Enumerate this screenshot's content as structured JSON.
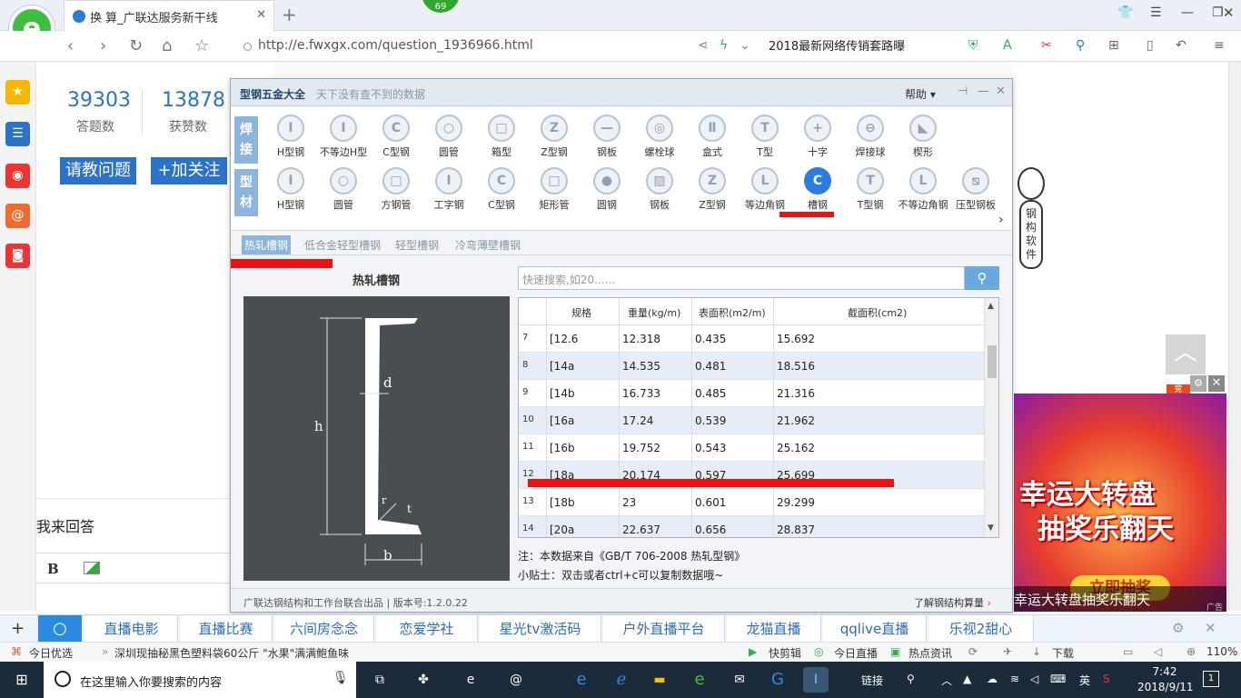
{
  "browser": {
    "tab_title": "换 算_广联达服务新干线",
    "badge": "69",
    "url": "http://e.fwxgx.com/question_1936966.html",
    "search_text": "2018最新网络传销套路曝"
  },
  "page": {
    "stat1_value": "39303",
    "stat1_label": "答题数",
    "stat2_value": "13878",
    "stat2_label": "获赞数",
    "ask_button": "请教问题",
    "follow_button": "+加关注",
    "reply_label": "我来回答",
    "bold_button": "B"
  },
  "dialog": {
    "title": "型钢五金大全",
    "subtitle": "天下没有查不到的数据",
    "help": "帮助",
    "row1_tag": "焊接",
    "row2_tag": "型材",
    "row1_items": [
      "H型钢",
      "不等边H型",
      "C型钢",
      "圆管",
      "箱型",
      "Z型钢",
      "钢板",
      "螺栓球",
      "盒式",
      "T型",
      "十字",
      "焊接球",
      "楔形"
    ],
    "row2_items": [
      "H型钢",
      "圆管",
      "方钢管",
      "工字钢",
      "C型钢",
      "矩形管",
      "圆钢",
      "钢板",
      "Z型钢",
      "等边角钢",
      "槽钢",
      "T型钢",
      "不等边角钢",
      "压型钢板"
    ],
    "sub_tabs": [
      "热轧槽钢",
      "低合金轻型槽钢",
      "轻型槽钢",
      "冷弯薄壁槽钢"
    ],
    "section_title": "热轧槽钢",
    "diagram_labels": {
      "h": "h",
      "d": "d",
      "b": "b",
      "t": "t",
      "r": "r"
    },
    "search_placeholder": "快速搜索,如20......",
    "columns": [
      "规格",
      "重量(kg/m)",
      "表面积(m2/m)",
      "截面积(cm2)"
    ],
    "rows": [
      {
        "n": "7",
        "spec": "[12.6",
        "w": "12.318",
        "s": "0.435",
        "a": "15.692"
      },
      {
        "n": "8",
        "spec": "[14a",
        "w": "14.535",
        "s": "0.481",
        "a": "18.516"
      },
      {
        "n": "9",
        "spec": "[14b",
        "w": "16.733",
        "s": "0.485",
        "a": "21.316"
      },
      {
        "n": "10",
        "spec": "[16a",
        "w": "17.24",
        "s": "0.539",
        "a": "21.962"
      },
      {
        "n": "11",
        "spec": "[16b",
        "w": "19.752",
        "s": "0.543",
        "a": "25.162"
      },
      {
        "n": "12",
        "spec": "[18a",
        "w": "20.174",
        "s": "0.597",
        "a": "25.699"
      },
      {
        "n": "13",
        "spec": "[18b",
        "w": "23",
        "s": "0.601",
        "a": "29.299"
      },
      {
        "n": "14",
        "spec": "[20a",
        "w": "22.637",
        "s": "0.656",
        "a": "28.837"
      }
    ],
    "note1": "注：本数据来自《GB/T  706-2008 热轧型钢》",
    "note2": "小贴士：双击或者ctrl+c可以复制数据哦~",
    "footer_left": "广联达钢结构和工作台联合出品  |  版本号:1.2.0.22",
    "footer_right": "了解钢结构算量"
  },
  "side": {
    "mascot_text": "钢构软件",
    "ad_label": "竞",
    "ad_line1": "幸运大转盘",
    "ad_line2": "抽奖乐翻天",
    "ad_button": "立即抽奖",
    "ad_caption": "幸运大转盘抽奖乐翻天",
    "ad_tag": "广告"
  },
  "hotlinks": [
    "直播电影",
    "直播比赛",
    "六间房念念",
    "恋爱学社",
    "星光tv激活码",
    "户外直播平台",
    "龙猫直播",
    "qqlive直播",
    "乐视2甜心"
  ],
  "statusbar": {
    "today": "今日优选",
    "news": "深圳现抽秘黑色塑料袋60公斤 \"水果\"满满鲍鱼味",
    "kuaibao": "快剪辑",
    "live": "今日直播",
    "hot": "热点资讯",
    "download": "下载",
    "zoom": "110%"
  },
  "taskbar": {
    "search_placeholder": "在这里输入你要搜索的内容",
    "link": "链接",
    "ime": "英",
    "time": "7:42",
    "date": "2018/9/11",
    "notif_count": "1"
  },
  "colors": {
    "accent": "#2a7de1",
    "red_mark": "#ee1111",
    "tag_blue": "#8db4dc"
  }
}
